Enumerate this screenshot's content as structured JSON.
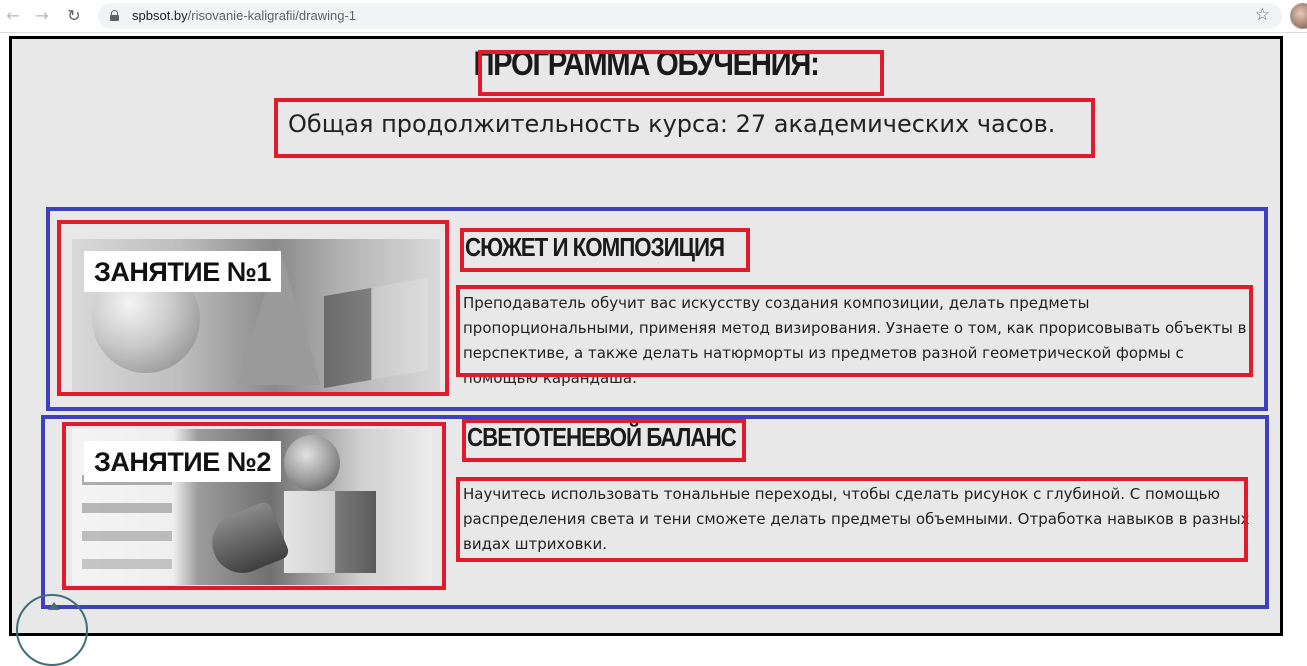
{
  "browser": {
    "url_host": "spbsot.by",
    "url_path": "/risovanie-kaligrafii/drawing-1",
    "icons": {
      "back": "arrow-left-icon",
      "forward": "arrow-right-icon",
      "reload": "reload-icon",
      "secure": "lock-icon",
      "bookmark": "star-icon",
      "profile": "avatar"
    }
  },
  "page": {
    "title": "ПРОГРАММА ОБУЧЕНИЯ:",
    "duration": "Общая продолжительность курса: 27 академических часов.",
    "lessons": [
      {
        "badge": "ЗАНЯТИЕ №1",
        "title": "СЮЖЕТ И КОМПОЗИЦИЯ",
        "text": "Преподаватель обучит вас искусству создания композиции, делать предметы пропорциональными, применяя метод визирования. Узнаете о том, как прорисовывать объекты в перспективе, а также делать натюрморты из предметов разной геометрической формы с помощью карандаша."
      },
      {
        "badge": "ЗАНЯТИЕ №2",
        "title": "СВЕТОТЕНЕВОЙ БАЛАНС",
        "text": "Научитесь использовать тональные переходы, чтобы сделать рисунок с глубиной. С помощью распределения света и тени сможете делать предметы объемными. Отработка навыков в разных видах штриховки."
      }
    ]
  },
  "colors": {
    "annotation_red": "#e01b2a",
    "annotation_blue": "#3e3fc2",
    "page_background": "#e9e8e9"
  }
}
